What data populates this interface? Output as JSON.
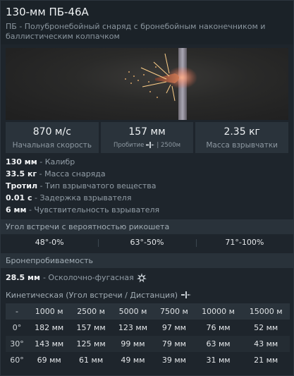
{
  "title": "130-мм ПБ-46А",
  "subtitle": "ПБ - Полубронебойный снаряд с бронебойным наконечником и баллистическим колпачком",
  "stats": [
    {
      "value": "870 м/с",
      "label": "Начальная скорость"
    },
    {
      "value": "157 мм",
      "label": "Пробитие",
      "label_suffix": "| 2500м"
    },
    {
      "value": "2.35 кг",
      "label": "Масса взрывчатки"
    }
  ],
  "props": [
    {
      "key": "130 мм",
      "desc": " - Калибр"
    },
    {
      "key": "33.5 кг",
      "desc": " - Масса снаряда"
    },
    {
      "key": "Тротил",
      "desc": " - Тип взрывчатого вещества"
    },
    {
      "key": "0.01 с",
      "desc": " - Задержка взрывателя"
    },
    {
      "key": "6 мм",
      "desc": " - Чувствительность взрывателя"
    }
  ],
  "ricochet": {
    "heading": "Угол встречи с вероятностью рикошета",
    "values": [
      "48°-0%",
      "63°-50%",
      "71°-100%"
    ]
  },
  "penetration": {
    "heading": "Бронепробиваемость",
    "he_key": "28.5 мм",
    "he_desc": " - Осколочно-фугасная"
  },
  "kinetic": {
    "heading": "Кинетическая (Угол встречи / Дистанция)",
    "corner": "-",
    "distances": [
      "1000 м",
      "2500 м",
      "5000 м",
      "7500 м",
      "10000 м",
      "15000 м"
    ],
    "rows": [
      {
        "angle": "0°",
        "values": [
          "182 мм",
          "157 мм",
          "123 мм",
          "97 мм",
          "76 мм",
          "52 мм"
        ]
      },
      {
        "angle": "30°",
        "values": [
          "143 мм",
          "125 мм",
          "99 мм",
          "79 мм",
          "63 мм",
          "43 мм"
        ]
      },
      {
        "angle": "60°",
        "values": [
          "69 мм",
          "61 мм",
          "49 мм",
          "39 мм",
          "31 мм",
          "21 мм"
        ]
      }
    ]
  },
  "icons": {
    "armor": "armor-plate-icon",
    "explosion": "explosion-icon"
  },
  "colors": {
    "background": "#1e252c",
    "tile": "#2a333b",
    "muted_text": "#8d98a1"
  }
}
